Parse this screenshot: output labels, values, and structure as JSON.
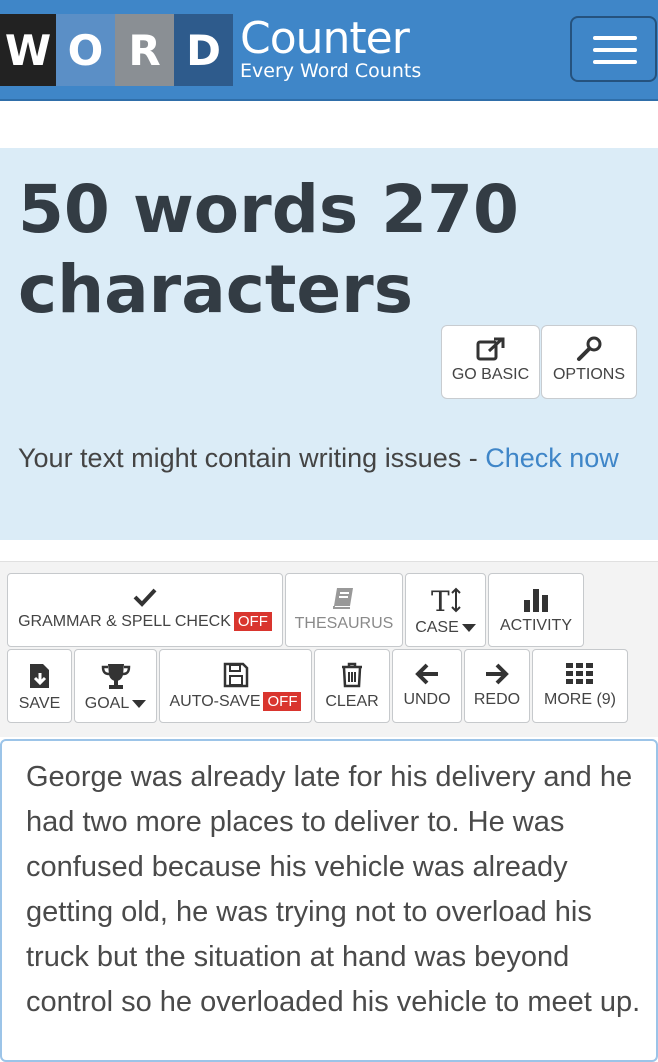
{
  "header": {
    "logo_letters": [
      "W",
      "O",
      "R",
      "D"
    ],
    "logo_word": "Counter",
    "tagline": "Every Word Counts"
  },
  "stats": {
    "count_line": "50 words 270 characters",
    "buttons": {
      "go_basic": "GO BASIC",
      "options": "OPTIONS"
    },
    "issue_text": "Your text might contain writing issues - ",
    "issue_link": "Check now"
  },
  "toolbar": {
    "grammar": "GRAMMAR & SPELL CHECK",
    "grammar_state": "OFF",
    "thesaurus": "THESAURUS",
    "case": "CASE",
    "activity": "ACTIVITY",
    "save": "SAVE",
    "goal": "GOAL",
    "autosave": "AUTO-SAVE",
    "autosave_state": "OFF",
    "clear": "CLEAR",
    "undo": "UNDO",
    "redo": "REDO",
    "more": "MORE (9)"
  },
  "editor": {
    "text": "George was already late for his delivery and he had two more places to deliver to. He was confused because his vehicle was already getting old, he was trying not to overload his truck but the situation at hand was beyond control so he overloaded his vehicle to meet up."
  },
  "colors": {
    "header_bg": "#3f86c8",
    "stats_bg": "#dbecf7",
    "off_badge": "#d9352e",
    "link": "#3f86c8"
  },
  "icons": [
    "hamburger-menu-icon",
    "external-link-icon",
    "wrench-icon",
    "checkmark-icon",
    "book-icon",
    "text-case-icon",
    "bar-chart-icon",
    "download-file-icon",
    "trophy-icon",
    "floppy-disk-icon",
    "trash-icon",
    "arrow-left-icon",
    "arrow-right-icon",
    "grid-icon"
  ]
}
